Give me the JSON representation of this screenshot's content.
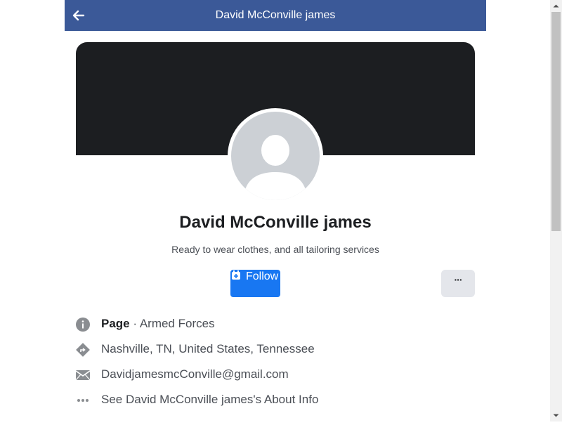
{
  "header": {
    "title": "David McConville james",
    "back_icon": "arrow-left-icon"
  },
  "profile": {
    "name": "David McConville james",
    "bio": "Ready to wear clothes, and all tailoring services",
    "avatar_icon": "default-user-avatar-icon"
  },
  "actions": {
    "follow_label": "Follow",
    "follow_icon": "follow-plus-icon",
    "more_label": "···"
  },
  "info": {
    "category_prefix": "Page",
    "category": "· Armed Forces",
    "location": "Nashville, TN, United States, Tennessee",
    "email": "DavidjamesmcConville@gmail.com",
    "about_link": "See David McConville james's About Info"
  },
  "colors": {
    "header_bg": "#3b5998",
    "cover_bg": "#1c1e21",
    "follow_bg": "#1877f2",
    "more_bg": "#e4e6eb",
    "text_primary": "#1c1e21",
    "text_secondary": "#4b4f56"
  }
}
